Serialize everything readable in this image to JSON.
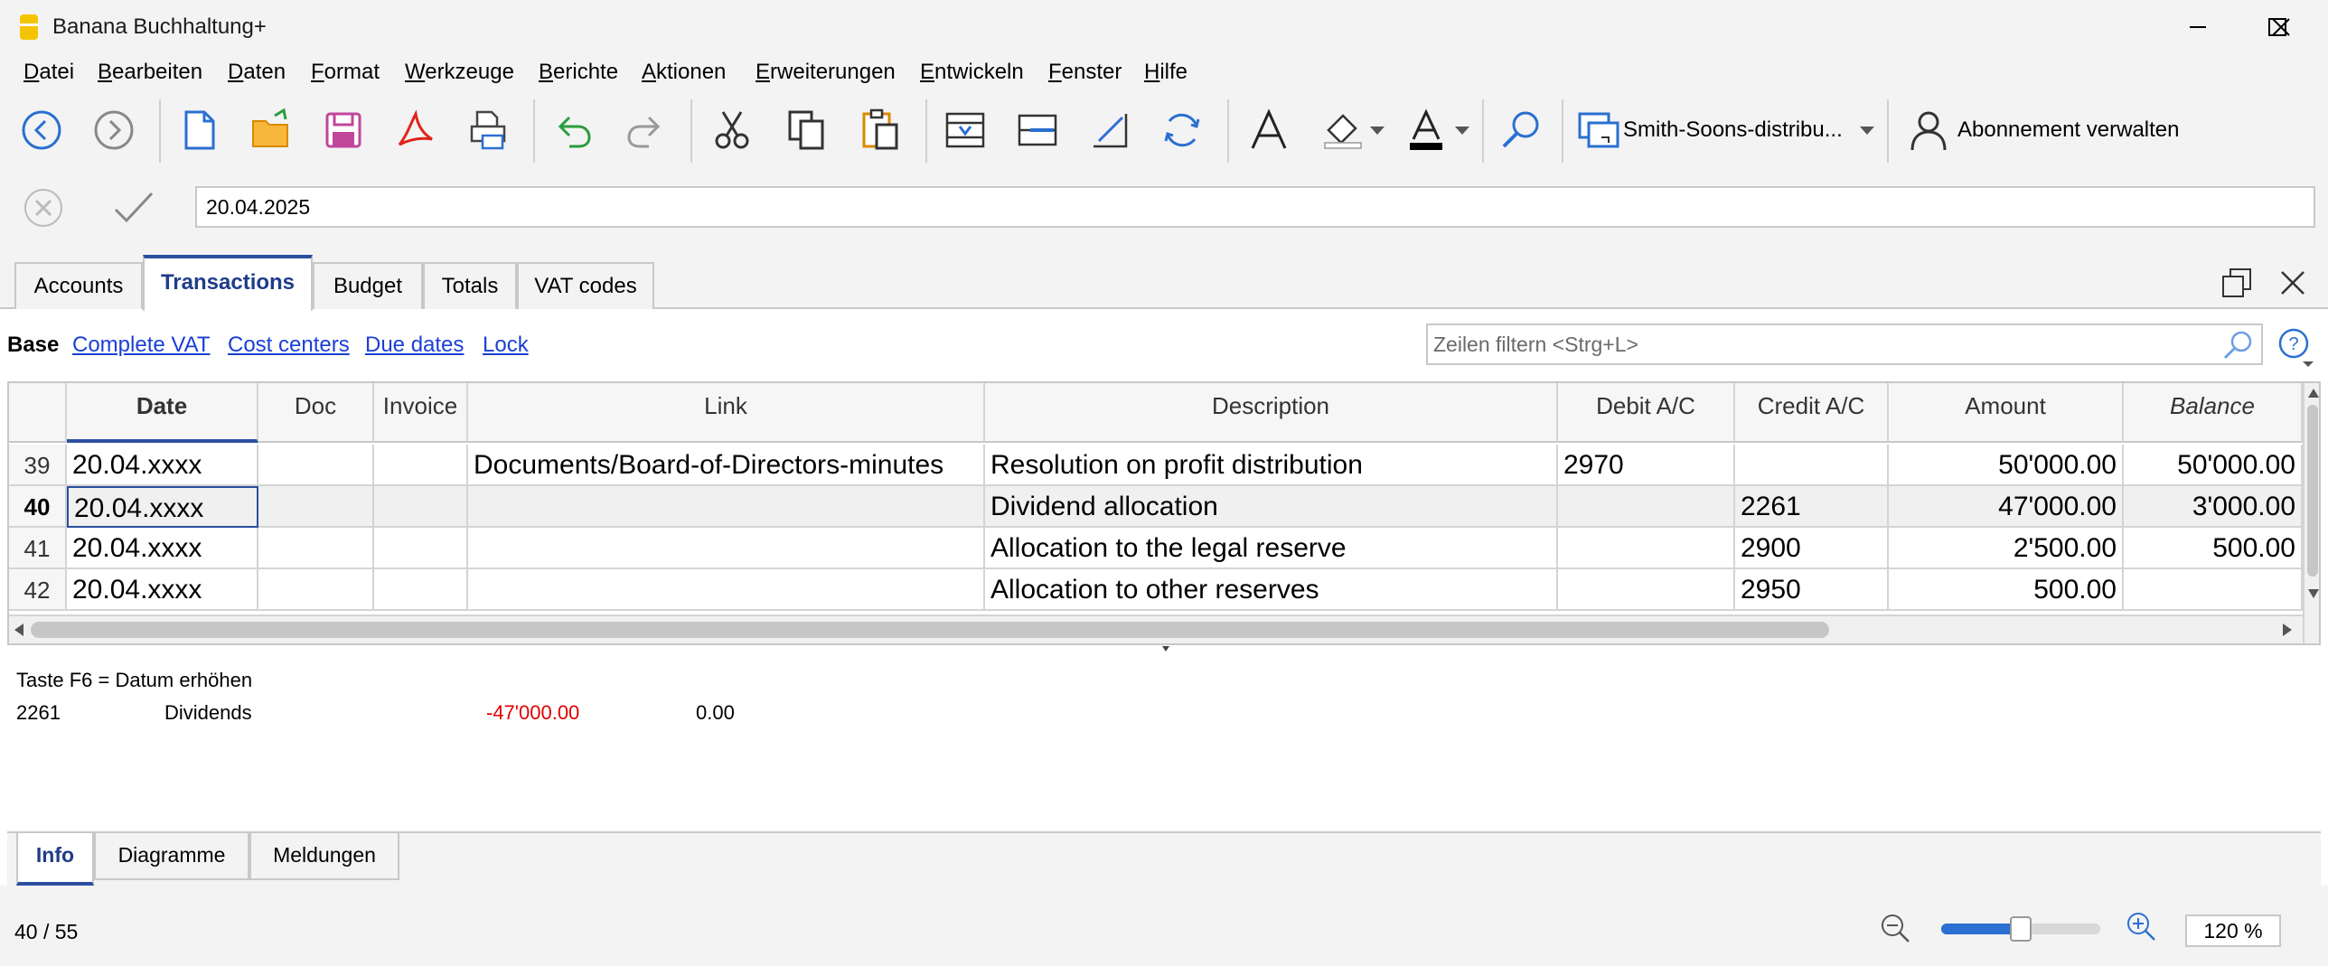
{
  "window": {
    "title": "Banana Buchhaltung+"
  },
  "menu": {
    "items": [
      {
        "label": "Datei",
        "ul": "D",
        "rest": "atei"
      },
      {
        "label": "Bearbeiten",
        "ul": "B",
        "rest": "earbeiten"
      },
      {
        "label": "Daten",
        "ul": "D",
        "rest": "aten"
      },
      {
        "label": "Format",
        "ul": "F",
        "rest": "ormat"
      },
      {
        "label": "Werkzeuge",
        "ul": "W",
        "rest": "erkzeuge"
      },
      {
        "label": "Berichte",
        "ul": "B",
        "rest": "erichte"
      },
      {
        "label": "Aktionen",
        "ul": "A",
        "rest": "ktionen"
      },
      {
        "label": "Erweiterungen",
        "ul": "E",
        "rest": "rweiterungen"
      },
      {
        "label": "Entwickeln",
        "ul": "E",
        "rest": "ntwickeln"
      },
      {
        "label": "Fenster",
        "ul": "F",
        "rest": "enster"
      },
      {
        "label": "Hilfe",
        "ul": "H",
        "rest": "ilfe"
      }
    ]
  },
  "toolbar": {
    "file_selector": "Smith-Soons-distribu...",
    "subscription": "Abonnement verwalten",
    "icons": [
      "back-icon",
      "forward-icon",
      "new-file-icon",
      "open-folder-icon",
      "save-icon",
      "pdf-icon",
      "print-icon",
      "undo-icon",
      "redo-icon",
      "cut-icon",
      "copy-icon",
      "paste-icon",
      "insert-rows-icon",
      "add-row-icon",
      "edit-icon",
      "refresh-icon",
      "font-icon",
      "fill-color-icon",
      "text-color-icon",
      "search-icon",
      "window-icon",
      "user-icon"
    ]
  },
  "edit": {
    "value": "20.04.2025"
  },
  "tabs": [
    {
      "label": "Accounts"
    },
    {
      "label": "Transactions"
    },
    {
      "label": "Budget"
    },
    {
      "label": "Totals"
    },
    {
      "label": "VAT codes"
    }
  ],
  "views": {
    "base": "Base",
    "links": [
      "Complete VAT",
      "Cost centers",
      "Due dates",
      "Lock"
    ],
    "filter_placeholder": "Zeilen filtern <Strg+L>"
  },
  "table": {
    "headers": [
      "Date",
      "Doc",
      "Invoice",
      "Link",
      "Description",
      "Debit A/C",
      "Credit A/C",
      "Amount",
      "Balance"
    ],
    "rows": [
      {
        "num": "39",
        "date": "20.04.xxxx",
        "doc": "",
        "invoice": "",
        "link": "Documents/Board-of-Directors-minutes",
        "desc": "Resolution on profit distribution",
        "debit": "2970",
        "credit": "",
        "amount": "50'000.00",
        "balance": "50'000.00"
      },
      {
        "num": "40",
        "date": "20.04.xxxx",
        "doc": "",
        "invoice": "",
        "link": "",
        "desc": "Dividend allocation",
        "debit": "",
        "credit": "2261",
        "amount": "47'000.00",
        "balance": "3'000.00"
      },
      {
        "num": "41",
        "date": "20.04.xxxx",
        "doc": "",
        "invoice": "",
        "link": "",
        "desc": "Allocation to the legal reserve",
        "debit": "",
        "credit": "2900",
        "amount": "2'500.00",
        "balance": "500.00"
      },
      {
        "num": "42",
        "date": "20.04.xxxx",
        "doc": "",
        "invoice": "",
        "link": "",
        "desc": "Allocation to other reserves",
        "debit": "",
        "credit": "2950",
        "amount": "500.00",
        "balance": ""
      }
    ]
  },
  "info": {
    "hint": "Taste F6 = Datum erhöhen",
    "account": "2261",
    "account_name": "Dividends",
    "value1": "-47'000.00",
    "value2": "0.00"
  },
  "bottom_tabs": [
    {
      "label": "Info"
    },
    {
      "label": "Diagramme"
    },
    {
      "label": "Meldungen"
    }
  ],
  "status": {
    "position": "40 / 55",
    "zoom": "120 %",
    "zoom_level": 0.5
  },
  "colors": {
    "accent": "#2a4ea0",
    "link": "#1a3fd6",
    "negative": "#e00000",
    "active_row": "#f0f0f0"
  }
}
